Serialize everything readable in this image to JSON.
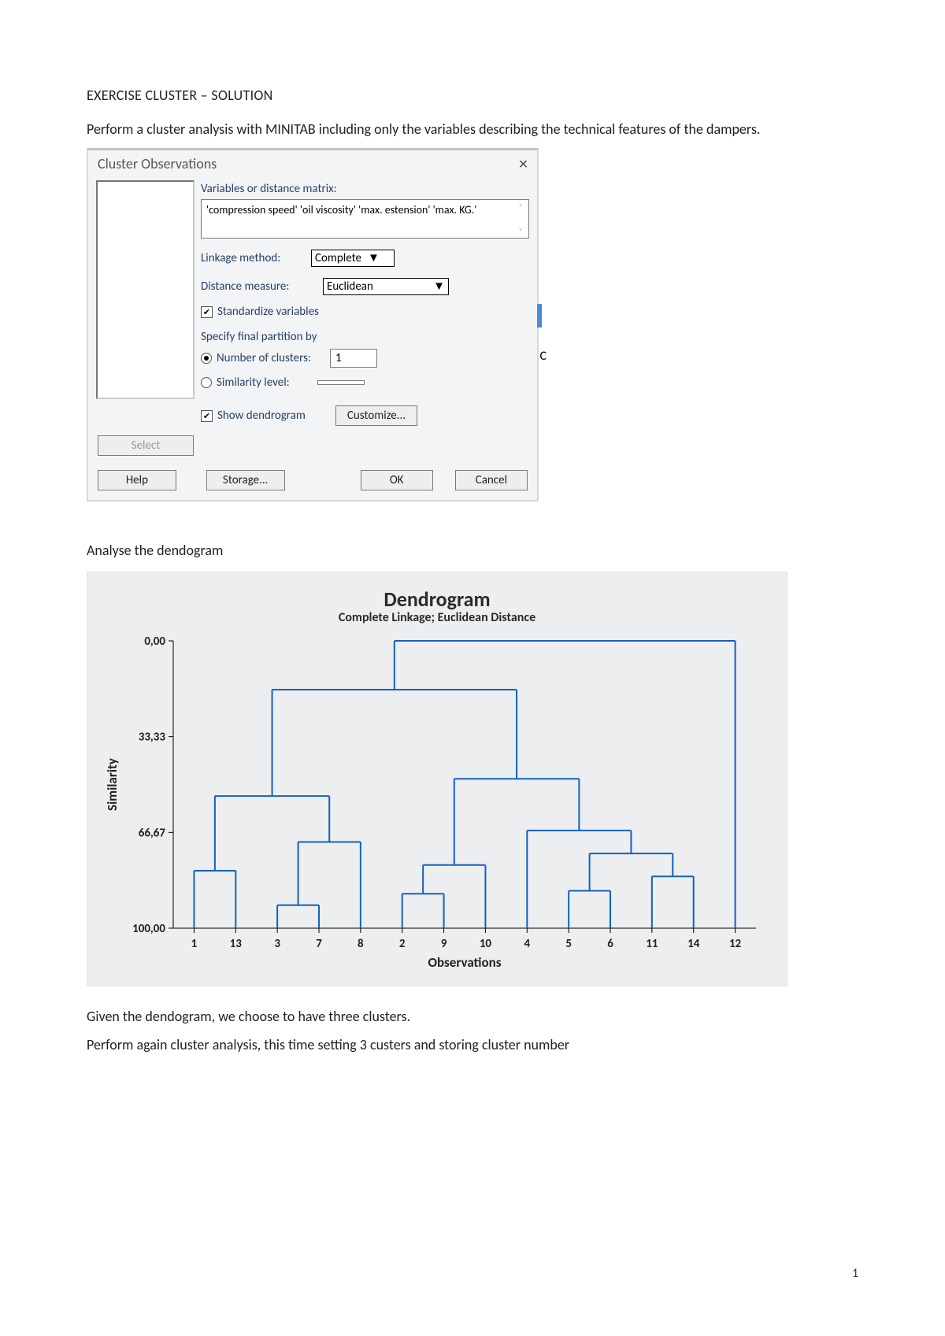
{
  "doc": {
    "title": "EXERCISE CLUSTER – SOLUTION",
    "para1": "Perform a cluster analysis with MINITAB including only the variables describing the technical features of the dampers.",
    "subhead2": "Analyse the dendogram",
    "para3": "Given the dendogram, we choose to have three clusters.",
    "para4": "Perform again cluster analysis, this time setting 3 custers and storing cluster number",
    "page_number": "1"
  },
  "dialog": {
    "title": "Cluster Observations",
    "close_glyph": "×",
    "label_vars": "Variables or distance matrix:",
    "vars_value": "'compression speed' 'oil viscosity' 'max. estension' 'max. KG.'",
    "label_linkage": "Linkage method:",
    "linkage_value": "Complete",
    "label_distance": "Distance measure:",
    "distance_value": "Euclidean",
    "chk_standardize": "Standardize variables",
    "label_specify": "Specify final partition by",
    "radio_nclusters": "Number of clusters:",
    "nclusters_value": "1",
    "radio_similarity": "Similarity level:",
    "chk_dendrogram": "Show dendrogram",
    "btn_customize": "Customize...",
    "btn_select": "Select",
    "btn_help": "Help",
    "btn_storage": "Storage...",
    "btn_ok": "OK",
    "btn_cancel": "Cancel",
    "side_letter": "C"
  },
  "chart_data": {
    "type": "dendrogram",
    "title": "Dendrogram",
    "subtitle": "Complete Linkage; Euclidean Distance",
    "ylabel": "Similarity",
    "xlabel": "Observations",
    "ylim": [
      100.0,
      0.0
    ],
    "yticks": [
      "0,00",
      "33,33",
      "66,67",
      "100,00"
    ],
    "leaf_order": [
      1,
      13,
      3,
      7,
      8,
      2,
      9,
      10,
      4,
      5,
      6,
      11,
      14,
      12
    ],
    "merges": [
      {
        "left": "leaf:3",
        "right": "leaf:7",
        "height": 92
      },
      {
        "left": "leaf:2",
        "right": "leaf:9",
        "height": 88
      },
      {
        "left": "leaf:5",
        "right": "leaf:6",
        "height": 87
      },
      {
        "left": "leaf:11",
        "right": "leaf:14",
        "height": 82
      },
      {
        "left": "leaf:1",
        "right": "leaf:13",
        "height": 80
      },
      {
        "left": "merge:1",
        "right": "leaf:10",
        "height": 78
      },
      {
        "left": "merge:2",
        "right": "merge:3",
        "height": 74
      },
      {
        "left": "merge:0",
        "right": "leaf:8",
        "height": 70
      },
      {
        "left": "leaf:4",
        "right": "merge:6",
        "height": 66
      },
      {
        "left": "merge:4",
        "right": "merge:7",
        "height": 54
      },
      {
        "left": "merge:5",
        "right": "merge:8",
        "height": 48
      },
      {
        "left": "merge:9",
        "right": "merge:10",
        "height": 17
      },
      {
        "left": "merge:11",
        "right": "leaf:12",
        "height": 0
      }
    ]
  }
}
